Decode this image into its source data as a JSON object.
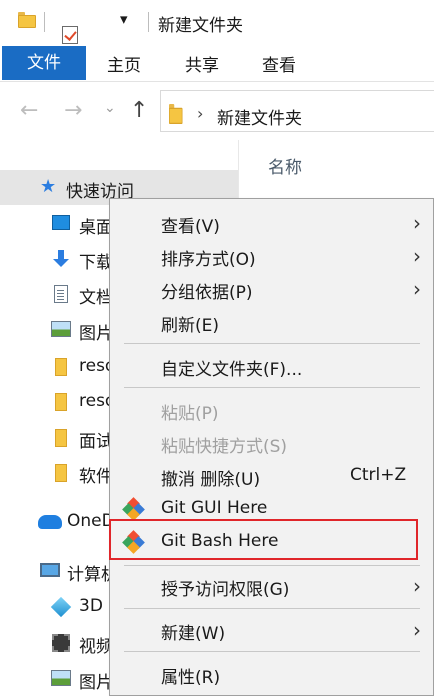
{
  "window": {
    "title": "新建文件夹"
  },
  "ribbon": {
    "tabs": [
      {
        "label": "文件",
        "active": true
      },
      {
        "label": "主页"
      },
      {
        "label": "共享"
      },
      {
        "label": "查看"
      }
    ],
    "accent_color": "#1a6cc4"
  },
  "address": {
    "path": "新建文件夹",
    "icons": [
      "back-arrow-icon",
      "forward-arrow-icon",
      "dropdown-chevron-icon",
      "up-arrow-icon",
      "folder-icon",
      "chevron-right-icon"
    ]
  },
  "nav": {
    "items": [
      {
        "label": "快速访问",
        "icon": "star-icon"
      },
      {
        "label": "桌面",
        "icon": "desktop-icon"
      },
      {
        "label": "下载",
        "icon": "download-icon"
      },
      {
        "label": "文档",
        "icon": "document-icon"
      },
      {
        "label": "图片",
        "icon": "picture-icon"
      },
      {
        "label": "reso",
        "icon": "folder-icon"
      },
      {
        "label": "reso",
        "icon": "folder-icon"
      },
      {
        "label": "面试",
        "icon": "folder-icon"
      },
      {
        "label": "软件",
        "icon": "folder-icon"
      },
      {
        "label": "OneD",
        "icon": "onedrive-icon"
      },
      {
        "label": "计算机",
        "icon": "computer-icon"
      },
      {
        "label": "3D",
        "icon": "3d-objects-icon"
      },
      {
        "label": "视频",
        "icon": "video-icon"
      },
      {
        "label": "图片",
        "icon": "picture-icon"
      }
    ]
  },
  "content": {
    "column_name": "名称"
  },
  "menu": {
    "items": [
      {
        "label": "查看(V)",
        "submenu": true
      },
      {
        "label": "排序方式(O)",
        "submenu": true
      },
      {
        "label": "分组依据(P)",
        "submenu": true
      },
      {
        "label": "刷新(E)"
      },
      {
        "label": "自定义文件夹(F)..."
      },
      {
        "label": "粘贴(P)",
        "disabled": true
      },
      {
        "label": "粘贴快捷方式(S)",
        "disabled": true
      },
      {
        "label": "撤消 删除(U)",
        "shortcut": "Ctrl+Z"
      },
      {
        "label": "Git GUI Here",
        "icon": "git-gui-icon"
      },
      {
        "label": "Git Bash Here",
        "icon": "git-bash-icon",
        "highlighted": true
      },
      {
        "label": "授予访问权限(G)",
        "submenu": true
      },
      {
        "label": "新建(W)",
        "submenu": true
      },
      {
        "label": "属性(R)"
      }
    ],
    "highlight_color": "#e0262a"
  }
}
